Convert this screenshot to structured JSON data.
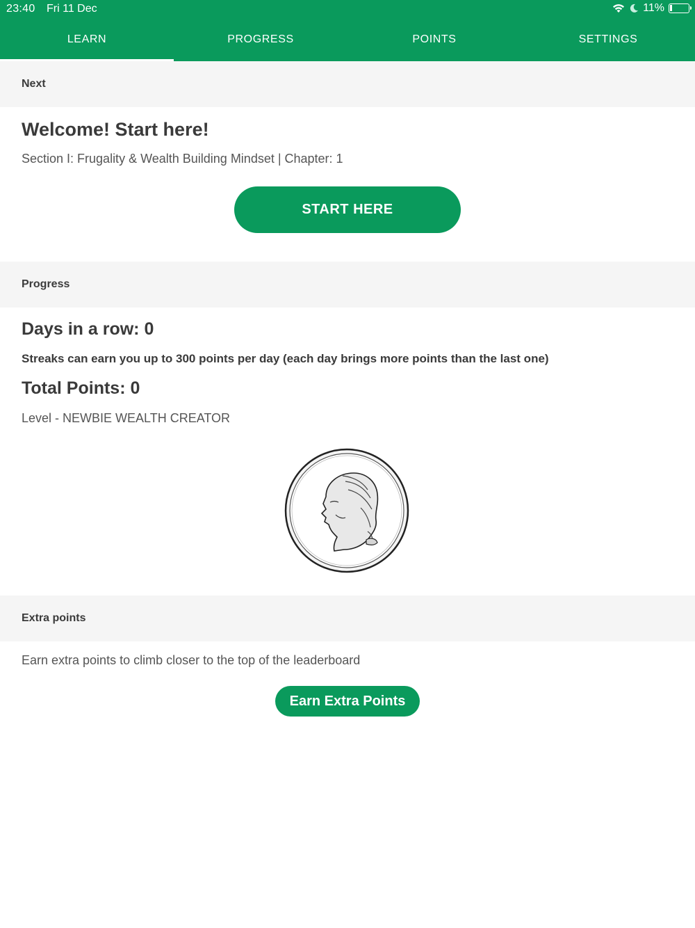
{
  "status_bar": {
    "time": "23:40",
    "date": "Fri 11 Dec",
    "battery": "11%"
  },
  "tabs": [
    {
      "label": "LEARN"
    },
    {
      "label": "PROGRESS"
    },
    {
      "label": "POINTS"
    },
    {
      "label": "SETTINGS"
    }
  ],
  "next_section": {
    "header": "Next",
    "title": "Welcome! Start here!",
    "subtitle": "Section I: Frugality & Wealth Building Mindset | Chapter: 1",
    "button": "START HERE"
  },
  "progress_section": {
    "header": "Progress",
    "days_in_row": "Days in a row: 0",
    "streak_note": "Streaks can earn you up to 300 points per day (each day brings more points than the last one)",
    "total_points": "Total Points: 0",
    "level": "Level - NEWBIE WEALTH CREATOR"
  },
  "extra_section": {
    "header": "Extra points",
    "description": "Earn extra points to climb closer to the top of the leaderboard",
    "button": "Earn Extra Points"
  },
  "colors": {
    "brand_green": "#0a9a5c",
    "section_bg": "#f5f5f5"
  }
}
